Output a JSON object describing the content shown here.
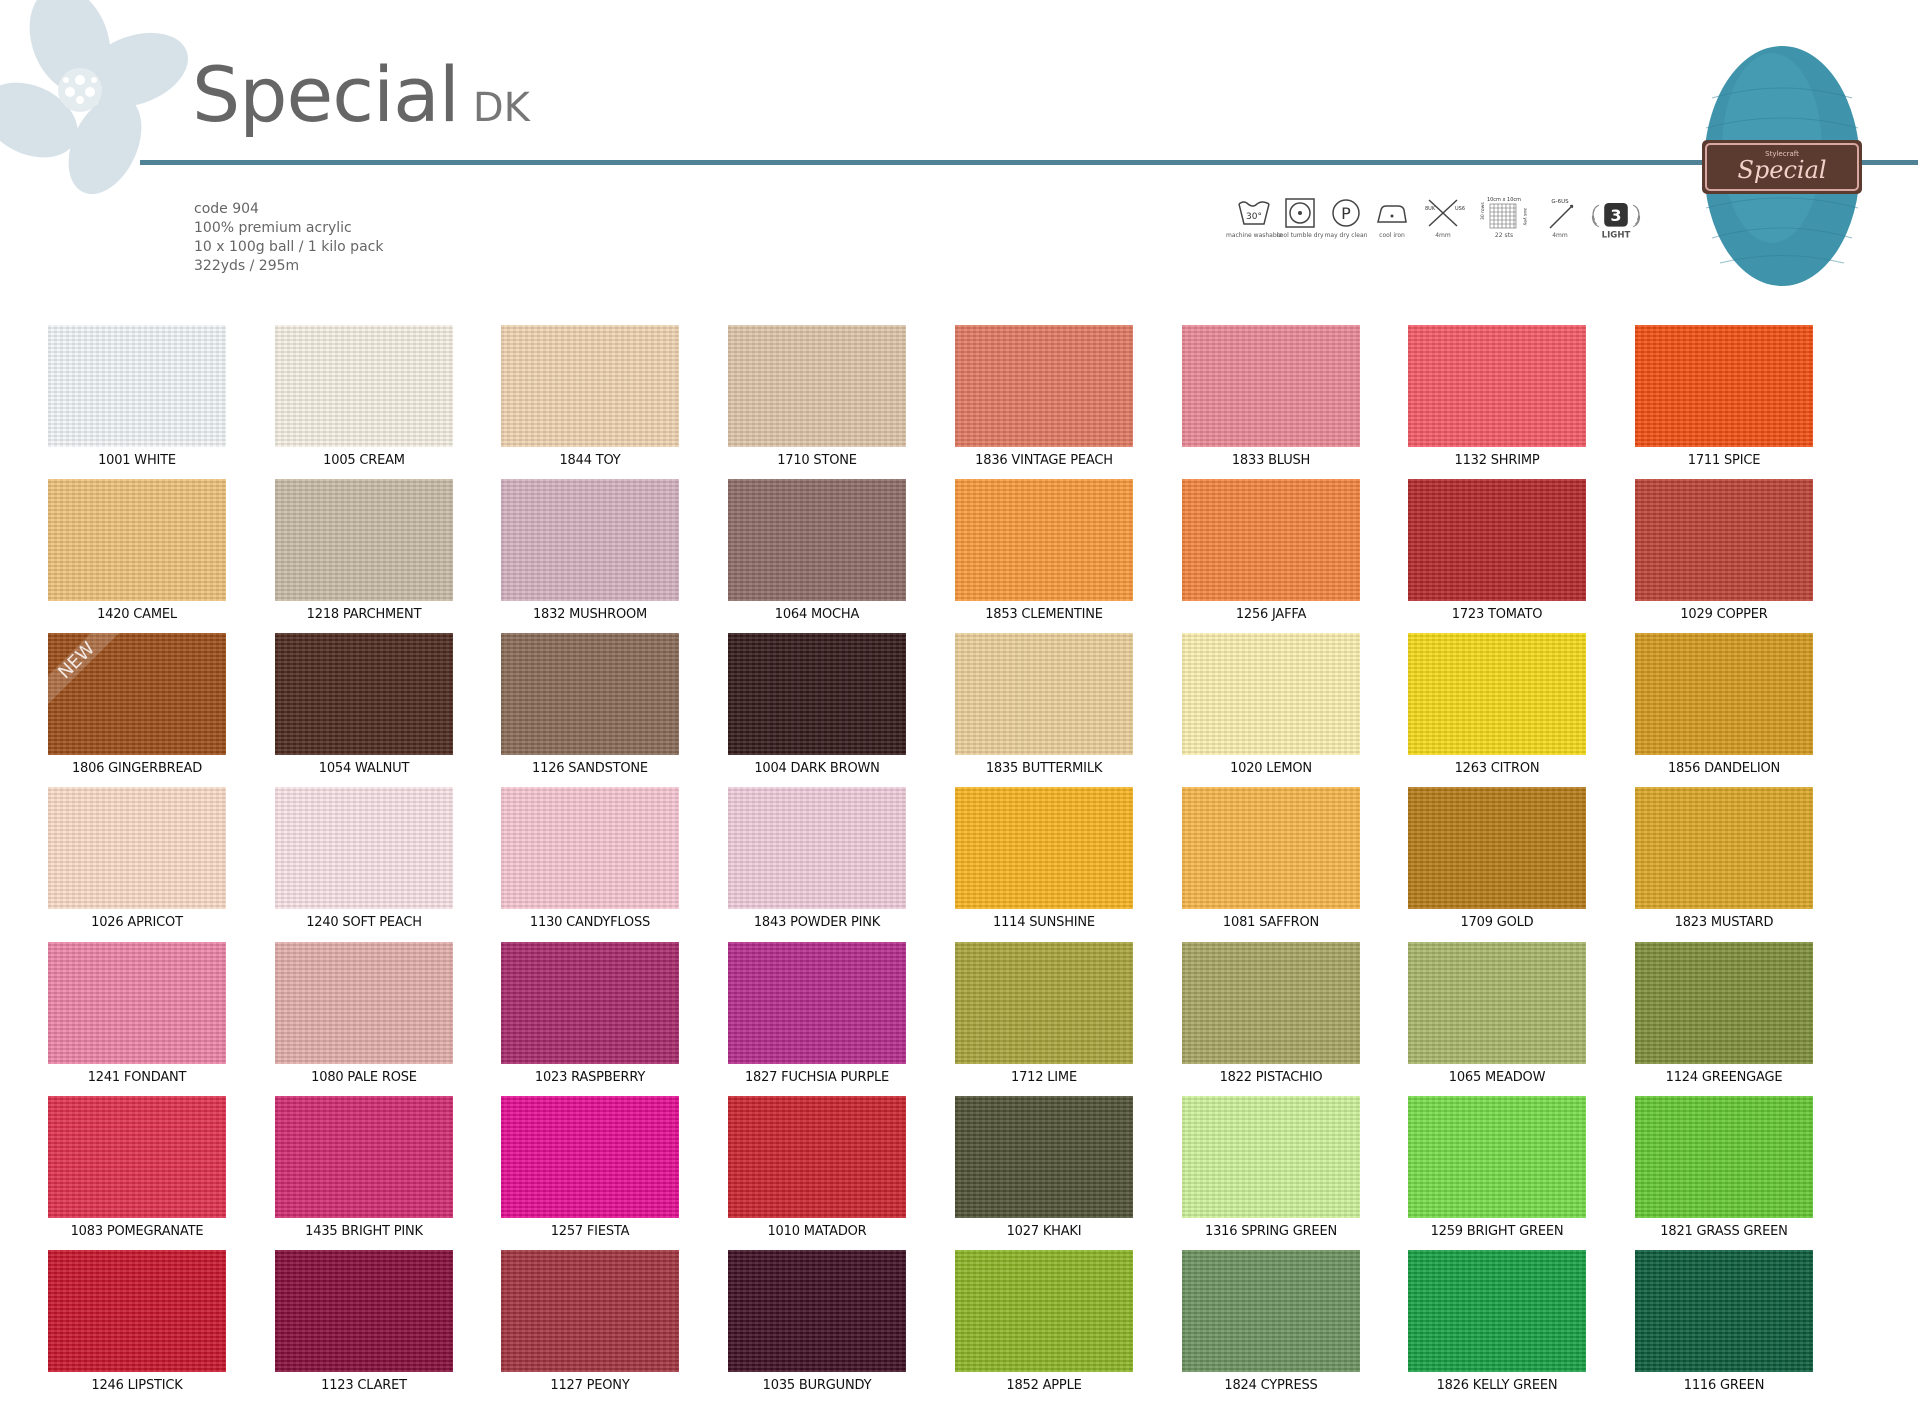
{
  "header": {
    "title": "Special",
    "subtitle": "DK"
  },
  "specs": {
    "code": "code 904",
    "fibre": "100% premium acrylic",
    "pack": "10 x 100g ball / 1 kilo pack",
    "length": "322yds / 295m"
  },
  "care": {
    "wash_temp": "30°",
    "wash_label": "machine washable",
    "tumble_label": "cool tumble dry",
    "dryclean_label": "may dry clean",
    "iron_label": "cool iron",
    "needles_uk": "8UK",
    "needles_us": "US6",
    "needles_mm": "4mm",
    "tension_top": "10cm x 10cm",
    "tension_rows": "30 rows",
    "tension_sts": "22 sts",
    "tension_side": "aus yey",
    "hook_size": "G-6US",
    "hook_mm": "4mm",
    "weight_number": "3",
    "weight_label": "LIGHT"
  },
  "ball_label": "Special",
  "ball_brand": "Stylecraft",
  "colors": {
    "accent_rule": "#4f8294",
    "ball": "#3f93ab"
  },
  "swatches": [
    {
      "label": "1001 WHITE",
      "color": "#f3f7f8"
    },
    {
      "label": "1005 CREAM",
      "color": "#f7f1e6"
    },
    {
      "label": "1844 TOY",
      "color": "#f1d5b3"
    },
    {
      "label": "1710 STONE",
      "color": "#dfc6ab"
    },
    {
      "label": "1836 VINTAGE PEACH",
      "color": "#e27a62"
    },
    {
      "label": "1833 BLUSH",
      "color": "#ec8a98"
    },
    {
      "label": "1132 SHRIMP",
      "color": "#f45b66"
    },
    {
      "label": "1711 SPICE",
      "color": "#f24f12"
    },
    {
      "label": "1420 CAMEL",
      "color": "#eec27c"
    },
    {
      "label": "1218 PARCHMENT",
      "color": "#c9bca6"
    },
    {
      "label": "1832 MUSHROOM",
      "color": "#d6b3c1"
    },
    {
      "label": "1064 MOCHA",
      "color": "#8e6d66"
    },
    {
      "label": "1853 CLEMENTINE",
      "color": "#fa9a3c"
    },
    {
      "label": "1256 JAFFA",
      "color": "#f5853f"
    },
    {
      "label": "1723 TOMATO",
      "color": "#b3282a"
    },
    {
      "label": "1029 COPPER",
      "color": "#bd4336"
    },
    {
      "label": "1806 GINGERBREAD",
      "color": "#9b4d18",
      "badge": "NEW"
    },
    {
      "label": "1054 WALNUT",
      "color": "#4d2a20"
    },
    {
      "label": "1126 SANDSTONE",
      "color": "#8a6b58"
    },
    {
      "label": "1004 DARK BROWN",
      "color": "#34191a"
    },
    {
      "label": "1835 BUTTERMILK",
      "color": "#ecd19b"
    },
    {
      "label": "1020 LEMON",
      "color": "#fbf0b0"
    },
    {
      "label": "1263 CITRON",
      "color": "#f5db17"
    },
    {
      "label": "1856 DANDELION",
      "color": "#d49a1d"
    },
    {
      "label": "1026 APRICOT",
      "color": "#fcdcc9"
    },
    {
      "label": "1240 SOFT PEACH",
      "color": "#fae4e8"
    },
    {
      "label": "1130 CANDYFLOSS",
      "color": "#f8c8d4"
    },
    {
      "label": "1843 POWDER PINK",
      "color": "#f0cedb"
    },
    {
      "label": "1114 SUNSHINE",
      "color": "#f8b420"
    },
    {
      "label": "1081 SAFFRON",
      "color": "#f8b64a"
    },
    {
      "label": "1709 GOLD",
      "color": "#b67b17"
    },
    {
      "label": "1823 MUSTARD",
      "color": "#dba626"
    },
    {
      "label": "1241 FONDANT",
      "color": "#ee85a9"
    },
    {
      "label": "1080 PALE ROSE",
      "color": "#e4afac"
    },
    {
      "label": "1023 RASPBERRY",
      "color": "#a72a6b"
    },
    {
      "label": "1827 FUCHSIA PURPLE",
      "color": "#b42b8c"
    },
    {
      "label": "1712 LIME",
      "color": "#a9a43d"
    },
    {
      "label": "1822 PISTACHIO",
      "color": "#a9a563"
    },
    {
      "label": "1065 MEADOW",
      "color": "#a8b76a"
    },
    {
      "label": "1124 GREENGAGE",
      "color": "#7e8f3a"
    },
    {
      "label": "1083 POMEGRANATE",
      "color": "#e0304e"
    },
    {
      "label": "1435 BRIGHT PINK",
      "color": "#d12b70"
    },
    {
      "label": "1257 FIESTA",
      "color": "#e50c93"
    },
    {
      "label": "1010 MATADOR",
      "color": "#c9242d"
    },
    {
      "label": "1027 KHAKI",
      "color": "#4f5136"
    },
    {
      "label": "1316 SPRING GREEN",
      "color": "#cdf39a"
    },
    {
      "label": "1259 BRIGHT GREEN",
      "color": "#76dc47"
    },
    {
      "label": "1821 GRASS GREEN",
      "color": "#64c831"
    },
    {
      "label": "1246 LIPSTICK",
      "color": "#c8142a"
    },
    {
      "label": "1123 CLARET",
      "color": "#850d3a"
    },
    {
      "label": "1127 PEONY",
      "color": "#a1343f"
    },
    {
      "label": "1035 BURGUNDY",
      "color": "#3e0f22"
    },
    {
      "label": "1852 APPLE",
      "color": "#8cb526"
    },
    {
      "label": "1824 CYPRESS",
      "color": "#6c925e"
    },
    {
      "label": "1826 KELLY GREEN",
      "color": "#15a042"
    },
    {
      "label": "1116 GREEN",
      "color": "#0b5c3b"
    }
  ]
}
